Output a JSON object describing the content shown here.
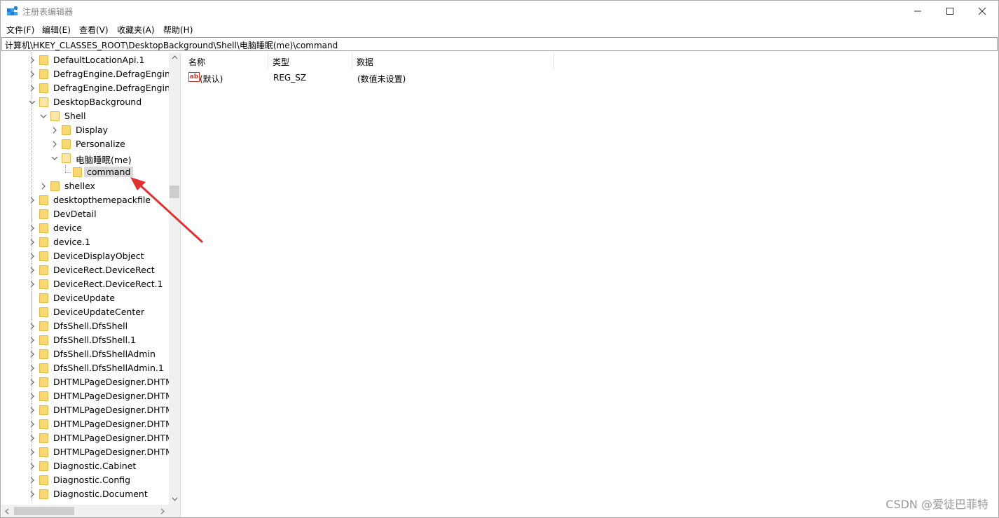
{
  "window": {
    "title": "注册表编辑器"
  },
  "menu": [
    "文件(F)",
    "编辑(E)",
    "查看(V)",
    "收藏夹(A)",
    "帮助(H)"
  ],
  "address": "计算机\\HKEY_CLASSES_ROOT\\DesktopBackground\\Shell\\电脑睡眠(me)\\command",
  "tree": [
    {
      "label": "DefaultLocationApi.1",
      "level": 0,
      "expander": "collapsed"
    },
    {
      "label": "DefragEngine.DefragEngine",
      "level": 0,
      "expander": "collapsed"
    },
    {
      "label": "DefragEngine.DefragEngine.",
      "level": 0,
      "expander": "collapsed"
    },
    {
      "label": "DesktopBackground",
      "level": 0,
      "expander": "expanded"
    },
    {
      "label": "Shell",
      "level": 1,
      "expander": "expanded"
    },
    {
      "label": "Display",
      "level": 2,
      "expander": "collapsed"
    },
    {
      "label": "Personalize",
      "level": 2,
      "expander": "collapsed"
    },
    {
      "label": "电脑睡眠(me)",
      "level": 2,
      "expander": "expanded"
    },
    {
      "label": "command",
      "level": 3,
      "expander": "none",
      "selected": true
    },
    {
      "label": "shellex",
      "level": 1,
      "expander": "collapsed"
    },
    {
      "label": "desktopthemepackfile",
      "level": 0,
      "expander": "collapsed"
    },
    {
      "label": "DevDetail",
      "level": 0,
      "expander": "none"
    },
    {
      "label": "device",
      "level": 0,
      "expander": "collapsed"
    },
    {
      "label": "device.1",
      "level": 0,
      "expander": "collapsed"
    },
    {
      "label": "DeviceDisplayObject",
      "level": 0,
      "expander": "collapsed"
    },
    {
      "label": "DeviceRect.DeviceRect",
      "level": 0,
      "expander": "collapsed"
    },
    {
      "label": "DeviceRect.DeviceRect.1",
      "level": 0,
      "expander": "collapsed"
    },
    {
      "label": "DeviceUpdate",
      "level": 0,
      "expander": "none"
    },
    {
      "label": "DeviceUpdateCenter",
      "level": 0,
      "expander": "none"
    },
    {
      "label": "DfsShell.DfsShell",
      "level": 0,
      "expander": "collapsed"
    },
    {
      "label": "DfsShell.DfsShell.1",
      "level": 0,
      "expander": "collapsed"
    },
    {
      "label": "DfsShell.DfsShellAdmin",
      "level": 0,
      "expander": "collapsed"
    },
    {
      "label": "DfsShell.DfsShellAdmin.1",
      "level": 0,
      "expander": "collapsed"
    },
    {
      "label": "DHTMLPageDesigner.DHTM",
      "level": 0,
      "expander": "collapsed"
    },
    {
      "label": "DHTMLPageDesigner.DHTM",
      "level": 0,
      "expander": "collapsed"
    },
    {
      "label": "DHTMLPageDesigner.DHTM",
      "level": 0,
      "expander": "collapsed"
    },
    {
      "label": "DHTMLPageDesigner.DHTM",
      "level": 0,
      "expander": "collapsed"
    },
    {
      "label": "DHTMLPageDesigner.DHTM",
      "level": 0,
      "expander": "collapsed"
    },
    {
      "label": "DHTMLPageDesigner.DHTM",
      "level": 0,
      "expander": "collapsed"
    },
    {
      "label": "Diagnostic.Cabinet",
      "level": 0,
      "expander": "collapsed"
    },
    {
      "label": "Diagnostic.Config",
      "level": 0,
      "expander": "collapsed"
    },
    {
      "label": "Diagnostic.Document",
      "level": 0,
      "expander": "collapsed"
    }
  ],
  "columns": {
    "name": "名称",
    "type": "类型",
    "data": "数据"
  },
  "values": [
    {
      "name": "(默认)",
      "type": "REG_SZ",
      "data": "(数值未设置)",
      "icon": "ab-string-icon"
    }
  ],
  "watermark": "CSDN @爱徒巴菲特",
  "colors": {
    "arrow": "#e03030",
    "folder": "#f8d775",
    "selection": "#d9d9d9"
  }
}
